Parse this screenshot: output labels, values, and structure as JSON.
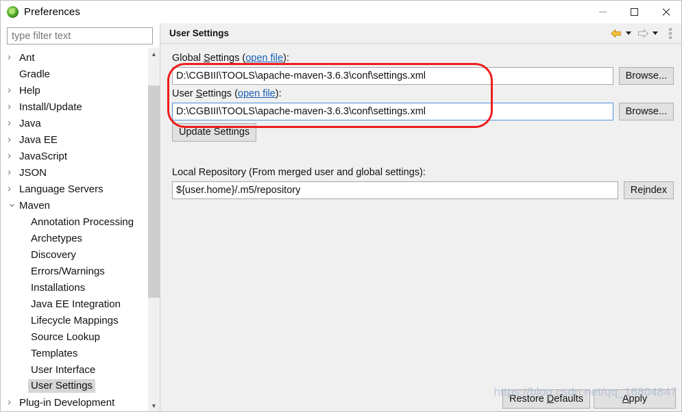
{
  "window": {
    "title": "Preferences",
    "icon": "eclipse-icon",
    "controls": {
      "minimize": "minimize-icon",
      "maximize": "maximize-icon",
      "close": "close-icon"
    }
  },
  "sidebar": {
    "filter": {
      "value": "",
      "placeholder": "type filter text"
    },
    "items": [
      {
        "label": "Ant",
        "level": 0,
        "twisty": "collapsed",
        "selected": false
      },
      {
        "label": "Gradle",
        "level": 0,
        "twisty": "none",
        "selected": false
      },
      {
        "label": "Help",
        "level": 0,
        "twisty": "collapsed",
        "selected": false
      },
      {
        "label": "Install/Update",
        "level": 0,
        "twisty": "collapsed",
        "selected": false
      },
      {
        "label": "Java",
        "level": 0,
        "twisty": "collapsed",
        "selected": false
      },
      {
        "label": "Java EE",
        "level": 0,
        "twisty": "collapsed",
        "selected": false
      },
      {
        "label": "JavaScript",
        "level": 0,
        "twisty": "collapsed",
        "selected": false
      },
      {
        "label": "JSON",
        "level": 0,
        "twisty": "collapsed",
        "selected": false
      },
      {
        "label": "Language Servers",
        "level": 0,
        "twisty": "collapsed",
        "selected": false
      },
      {
        "label": "Maven",
        "level": 0,
        "twisty": "expanded",
        "selected": false
      },
      {
        "label": "Annotation Processing",
        "level": 1,
        "twisty": "none",
        "selected": false
      },
      {
        "label": "Archetypes",
        "level": 1,
        "twisty": "none",
        "selected": false
      },
      {
        "label": "Discovery",
        "level": 1,
        "twisty": "none",
        "selected": false
      },
      {
        "label": "Errors/Warnings",
        "level": 1,
        "twisty": "none",
        "selected": false
      },
      {
        "label": "Installations",
        "level": 1,
        "twisty": "none",
        "selected": false
      },
      {
        "label": "Java EE Integration",
        "level": 1,
        "twisty": "none",
        "selected": false
      },
      {
        "label": "Lifecycle Mappings",
        "level": 1,
        "twisty": "none",
        "selected": false
      },
      {
        "label": "Source Lookup",
        "level": 1,
        "twisty": "none",
        "selected": false
      },
      {
        "label": "Templates",
        "level": 1,
        "twisty": "none",
        "selected": false
      },
      {
        "label": "User Interface",
        "level": 1,
        "twisty": "none",
        "selected": false
      },
      {
        "label": "User Settings",
        "level": 1,
        "twisty": "none",
        "selected": true
      },
      {
        "label": "Plug-in Development",
        "level": 0,
        "twisty": "collapsed",
        "selected": false
      }
    ],
    "scrollbar": {
      "up_arrow": "chevron-up-icon",
      "down_arrow": "chevron-down-icon"
    }
  },
  "page": {
    "title": "User Settings",
    "toolbar": {
      "back": "back-arrow-icon",
      "back_menu": "caret-down-icon",
      "forward": "forward-arrow-icon",
      "forward_menu": "caret-down-icon",
      "view_menu": "kebab-menu-icon"
    },
    "global_settings": {
      "label_prefix": "Global ",
      "label_underlined": "S",
      "label_suffix": "ettings (",
      "link": "open file",
      "label_end": "):",
      "value": "D:\\CGBIII\\TOOLS\\apache-maven-3.6.3\\conf\\settings.xml",
      "browse_label": "Browse..."
    },
    "user_settings": {
      "label_prefix": "User ",
      "label_underlined": "S",
      "label_suffix": "ettings (",
      "link": "open file",
      "label_end": "):",
      "value": "D:\\CGBIII\\TOOLS\\apache-maven-3.6.3\\conf\\settings.xml",
      "browse_label": "Browse...",
      "focused": true
    },
    "update_button": "Update Settings",
    "local_repository": {
      "label": "Local Repository (From merged user and global settings):",
      "value": "${user.home}/.m5/repository",
      "reindex_prefix": "Re",
      "reindex_underlined": "i",
      "reindex_suffix": "ndex"
    },
    "annotation": {
      "shape": "red-rounded-rectangle",
      "color": "#ee1c1c"
    }
  },
  "footer": {
    "restore_prefix": "Restore ",
    "restore_underlined": "D",
    "restore_suffix": "efaults",
    "apply_prefix": "",
    "apply_underlined": "A",
    "apply_suffix": "pply"
  },
  "watermark": "https://blog.csdn.net/qq_16804847"
}
